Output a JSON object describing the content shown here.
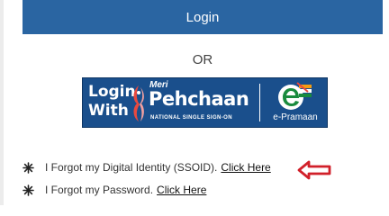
{
  "login": {
    "label": "Login"
  },
  "separator": {
    "label": "OR"
  },
  "meri_pehchaan": {
    "login_with_line1": "Login",
    "login_with_line2": "With",
    "meri": "Meri",
    "brand": "Pehchaan",
    "tagline": "NATIONAL SINGLE SIGN-ON",
    "epramaan_label": "e-Pramaan"
  },
  "links": [
    {
      "text": "I Forgot my Digital Identity (SSOID).",
      "link": "Click Here"
    },
    {
      "text": "I Forgot my Password.",
      "link": "Click Here"
    }
  ],
  "colors": {
    "login_bg": "#2a65a2",
    "banner_bg": "#1a4f8c",
    "arrow": "#d1202a"
  },
  "icons": {
    "bullet": "snowflake-icon",
    "arrow": "left-arrow-icon"
  }
}
